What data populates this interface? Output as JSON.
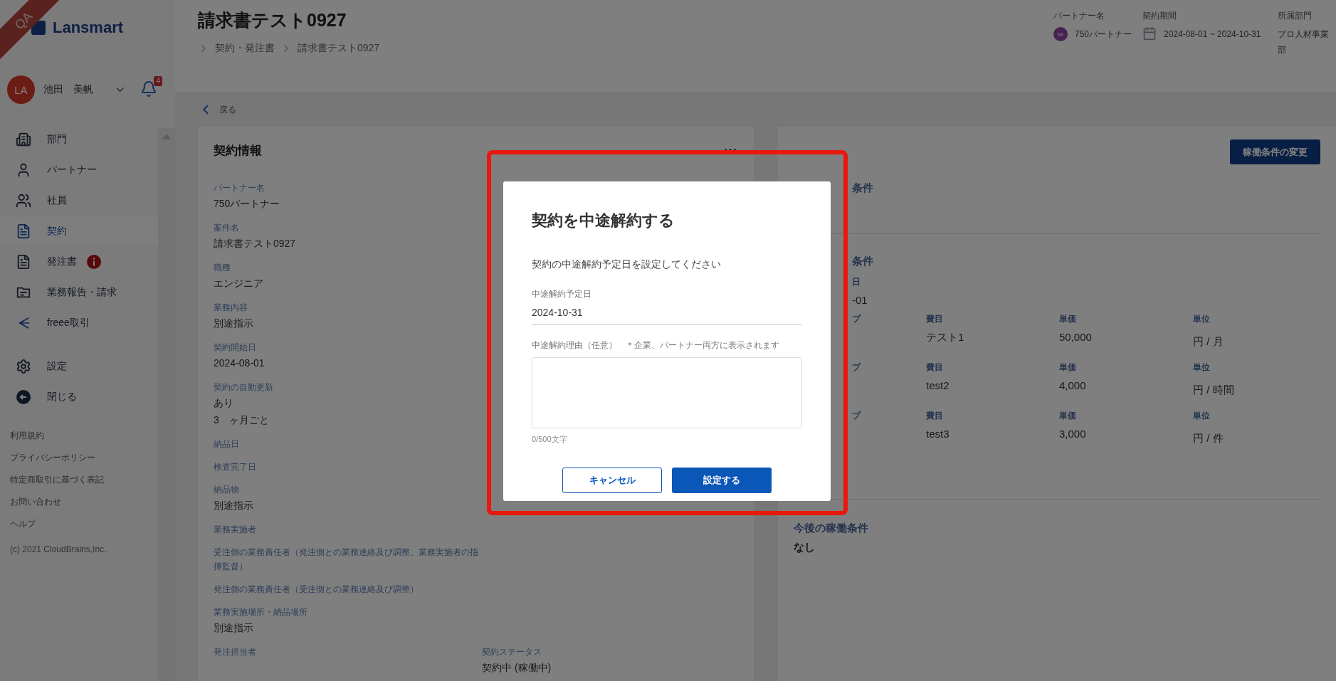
{
  "ribbon": {
    "text": "QA"
  },
  "logo": {
    "text": "Lansmart"
  },
  "user": {
    "initials": "LA",
    "name": "池田　美帆",
    "notifications": "4"
  },
  "nav": [
    {
      "label": "部門",
      "selected": false,
      "alert": false
    },
    {
      "label": "パートナー",
      "selected": false,
      "alert": false
    },
    {
      "label": "社員",
      "selected": false,
      "alert": false
    },
    {
      "label": "契約",
      "selected": true,
      "alert": false
    },
    {
      "label": "発注書",
      "selected": false,
      "alert": true
    },
    {
      "label": "業務報告・請求",
      "selected": false,
      "alert": false
    },
    {
      "label": "freee取引",
      "selected": false,
      "alert": false
    }
  ],
  "nav_bottom": [
    {
      "label": "設定"
    },
    {
      "label": "閉じる"
    }
  ],
  "footer_links": [
    "利用規約",
    "プライバシーポリシー",
    "特定商取引に基づく表記",
    "お問い合わせ",
    "ヘルプ"
  ],
  "copyright": "(c) 2021 CloudBrains,Inc.",
  "header": {
    "title": "請求書テスト0927",
    "breadcrumbs": [
      "契約・発注書",
      "請求書テスト0927"
    ],
    "meta": [
      {
        "kind": "avatar",
        "label": "パートナー名",
        "initials": "MI",
        "value": "750パートナー"
      },
      {
        "kind": "calendar",
        "label": "契約期間",
        "value": "2024-08-01 ~ 2024-10-31"
      },
      {
        "kind": "plain",
        "label": "所属部門",
        "value": "プロ人材事業部"
      }
    ]
  },
  "back": "戻る",
  "contract_info": {
    "title": "契約情報",
    "rows": [
      {
        "left": {
          "label": "パートナー名",
          "values": [
            "750パートナー"
          ]
        }
      },
      {
        "left": {
          "label": "案件名",
          "values": [
            "請求書テスト0927"
          ]
        }
      },
      {
        "left": {
          "label": "職種",
          "values": [
            "エンジニア"
          ]
        }
      },
      {
        "left": {
          "label": "業務内容",
          "values": [
            "別途指示"
          ]
        }
      },
      {
        "left": {
          "label": "契約開始日",
          "values": [
            "2024-08-01"
          ]
        }
      },
      {
        "left": {
          "label": "契約の自動更新",
          "values": [
            "あり",
            "3　ヶ月ごと"
          ]
        }
      },
      {
        "left": {
          "label": "納品日"
        }
      },
      {
        "left": {
          "label": "検査完了日"
        }
      },
      {
        "left": {
          "label": "納品物",
          "values": [
            "別途指示"
          ]
        }
      },
      {
        "left": {
          "label": "業務実施者"
        }
      },
      {
        "left": {
          "label": "受注側の業務責任者（発注側との業務連絡及び調整、業務実施者の指揮監督）"
        }
      },
      {
        "left": {
          "label": "発注側の業務責任者（受注側との業務連絡及び調整）"
        }
      },
      {
        "left": {
          "label": "業務実施場所・納品場所",
          "values": [
            "別途指示"
          ]
        }
      },
      {
        "left": {
          "label": "発注担当者"
        },
        "right": {
          "label": "契約ステータス",
          "values": [
            "契約中 (稼働中)"
          ]
        }
      }
    ]
  },
  "conditions": {
    "button": "稼働条件の変更",
    "first_heading": "条件",
    "second": {
      "heading": "条件",
      "date_label": "日",
      "date_value": "-01",
      "rows": [
        {
          "type_label": "プ",
          "item_label": "費目",
          "item": "テスト1",
          "price_label": "単価",
          "price": "50,000",
          "unit_label": "単位",
          "unit": "円 / 月"
        },
        {
          "type_label": "プ",
          "item_label": "費目",
          "item": "test2",
          "price_label": "単価",
          "price": "4,000",
          "unit_label": "単位",
          "unit": "円 / 時間"
        },
        {
          "type_label": "プ",
          "item_label": "費目",
          "item": "test3",
          "price_label": "単価",
          "price": "3,000",
          "unit_label": "単位",
          "unit": "円 / 件"
        }
      ]
    },
    "future": {
      "heading": "今後の稼働条件",
      "value": "なし"
    }
  },
  "dialog": {
    "title": "契約を中途解約する",
    "message": "契約の中途解約予定日を設定してください",
    "date_label": "中途解約予定日",
    "date_value": "2024-10-31",
    "reason_label": "中途解約理由（任意）",
    "reason_note": "＊企業、パートナー両方に表示されます",
    "counter": "0/500文字",
    "cancel": "キャンセル",
    "confirm": "設定する"
  }
}
